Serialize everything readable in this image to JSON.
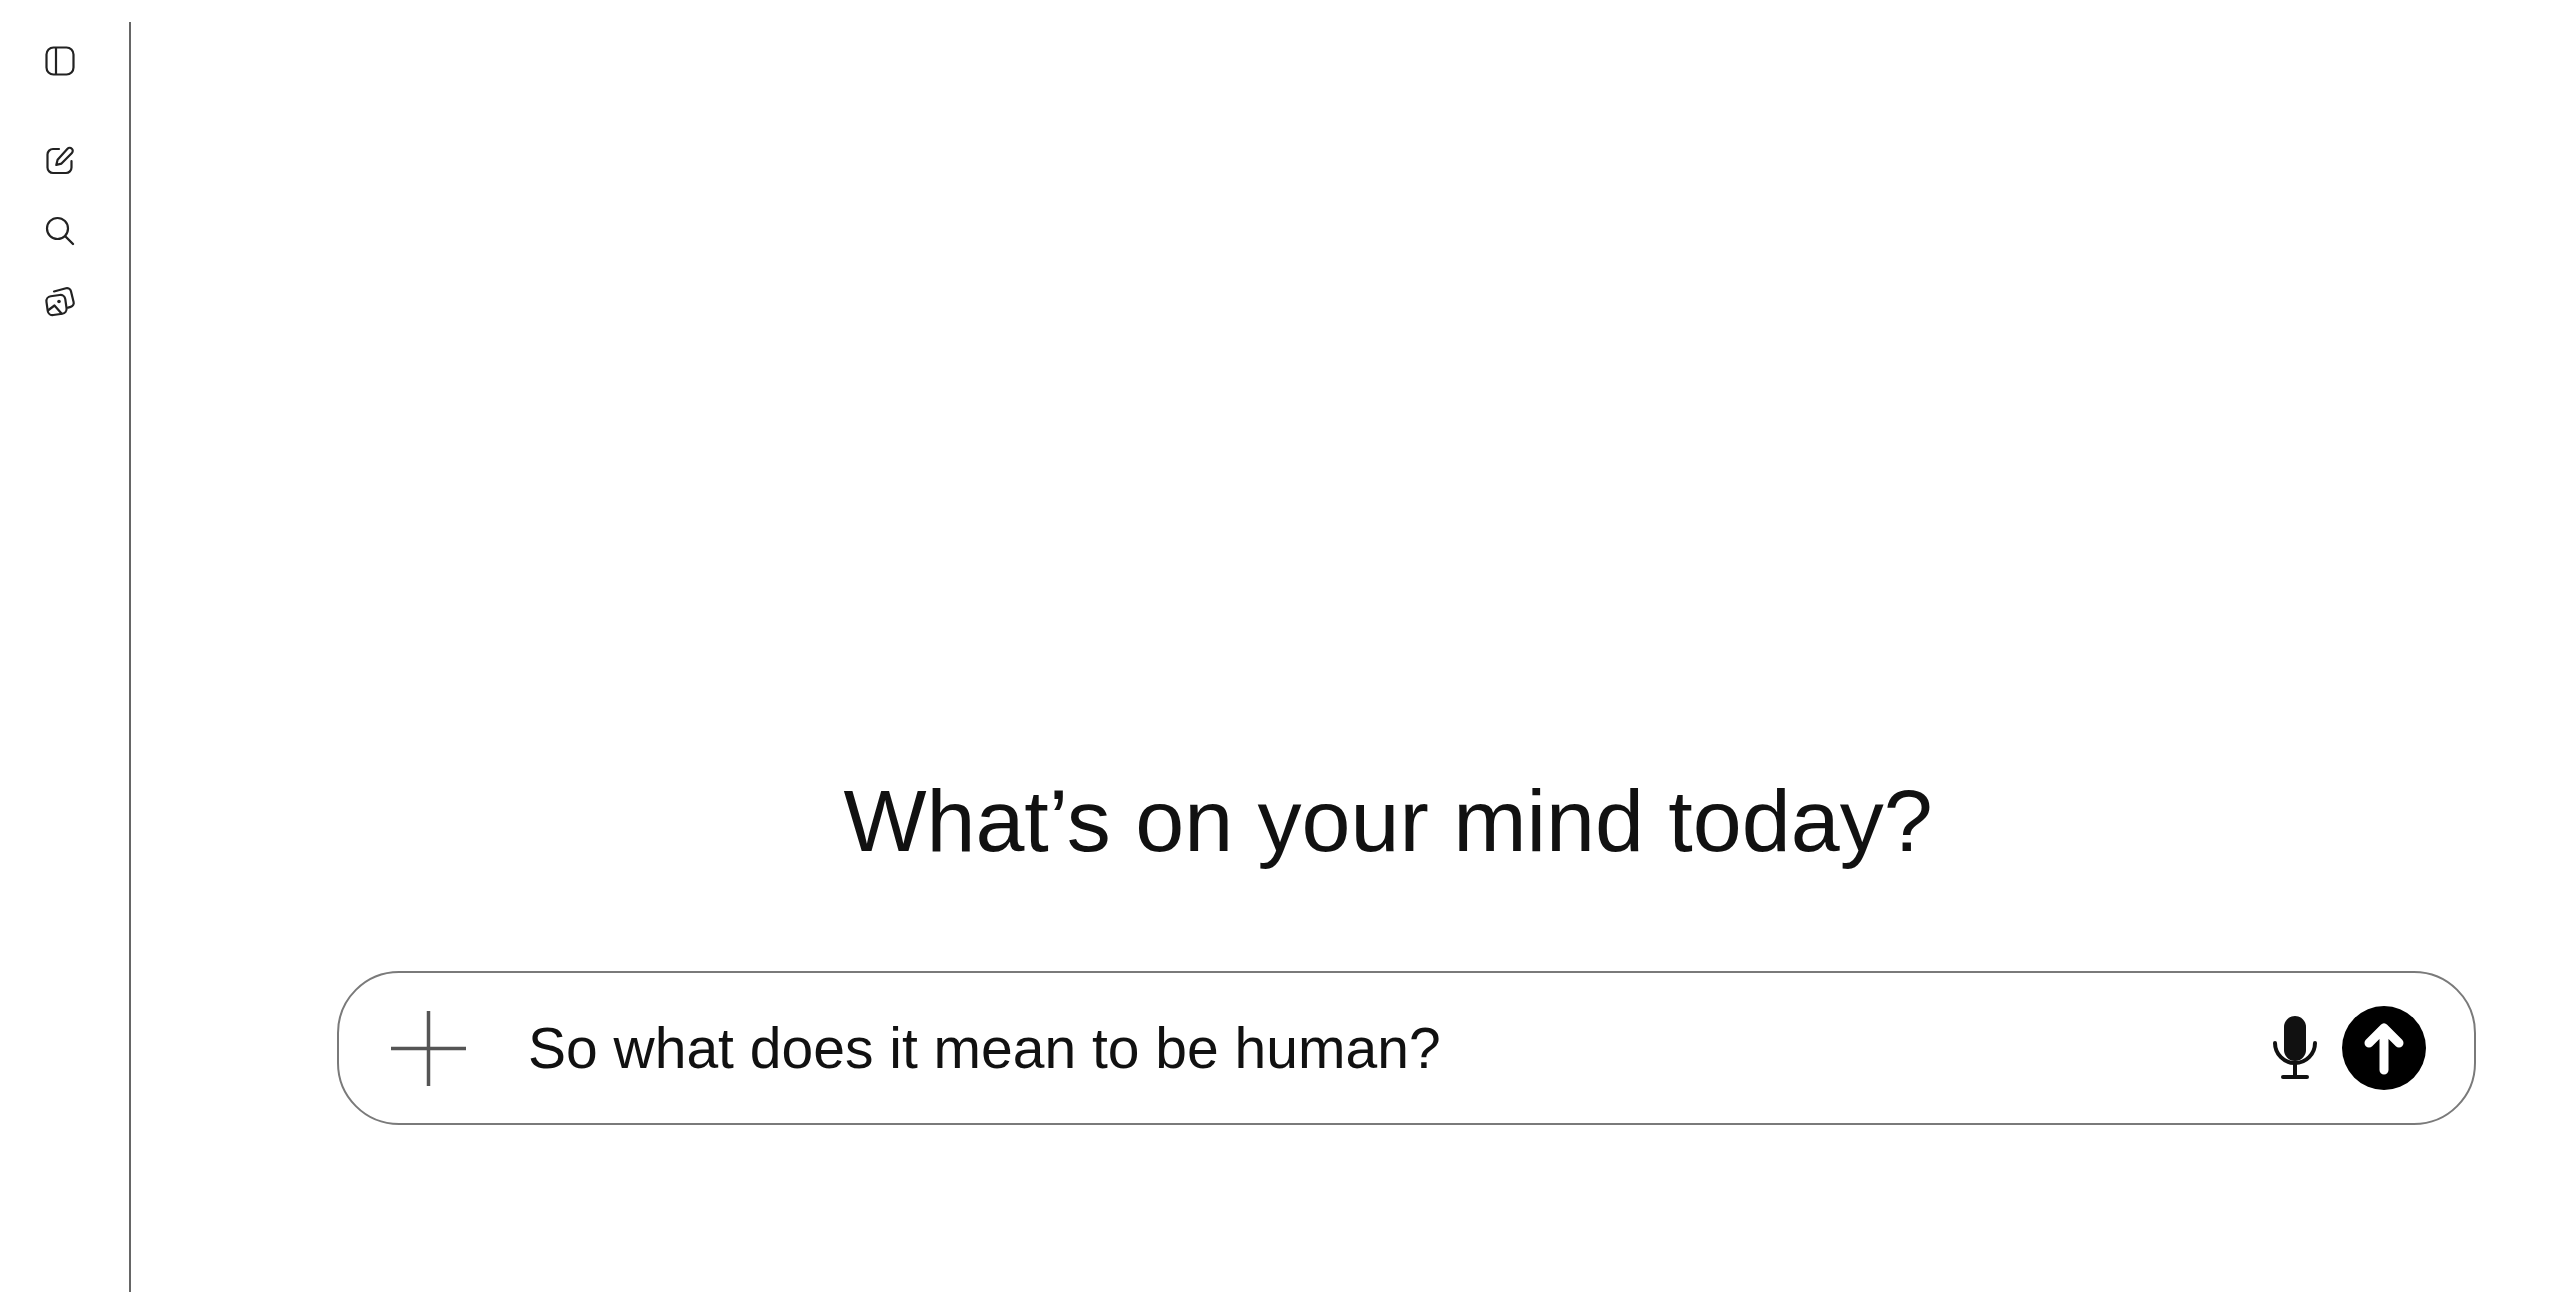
{
  "heading": "What’s on your mind today?",
  "composer": {
    "value": "So what does it mean to be human?"
  }
}
